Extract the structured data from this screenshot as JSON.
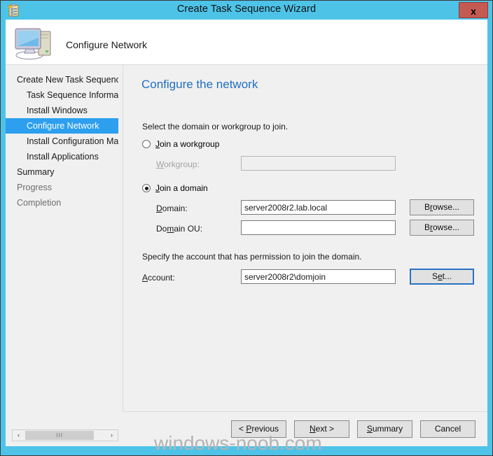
{
  "window": {
    "title": "Create Task Sequence Wizard",
    "title_icon": "task-sequence-clipboard-icon",
    "close_label": "x",
    "frame_color": "#4EC3E8",
    "close_color": "#C55A52"
  },
  "header": {
    "icon": "computer-icon",
    "title": "Configure Network"
  },
  "sidebar": {
    "items": [
      {
        "label": "Create New Task Sequence",
        "indent": false,
        "selected": false,
        "dim": false
      },
      {
        "label": "Task Sequence Information",
        "indent": true,
        "selected": false,
        "dim": false
      },
      {
        "label": "Install Windows",
        "indent": true,
        "selected": false,
        "dim": false
      },
      {
        "label": "Configure Network",
        "indent": true,
        "selected": true,
        "dim": false
      },
      {
        "label": "Install Configuration Manager",
        "indent": true,
        "selected": false,
        "dim": false
      },
      {
        "label": "Install Applications",
        "indent": true,
        "selected": false,
        "dim": false
      },
      {
        "label": "Summary",
        "indent": false,
        "selected": false,
        "dim": false
      },
      {
        "label": "Progress",
        "indent": false,
        "selected": false,
        "dim": true
      },
      {
        "label": "Completion",
        "indent": false,
        "selected": false,
        "dim": true
      }
    ],
    "selected_color": "#2C9FEE",
    "scrollbar": {
      "left_arrow": "‹",
      "right_arrow": "›",
      "grip": "III"
    }
  },
  "content": {
    "heading": "Configure the network",
    "heading_color": "#1F6FC4",
    "instruction_domain": "Select the domain or workgroup to join.",
    "instruction_account": "Specify the account that has permission to join the domain.",
    "radio_workgroup": {
      "label": "Join a workgroup",
      "selected": false
    },
    "radio_domain": {
      "label": "Join a domain",
      "selected": true
    },
    "fields": {
      "workgroup": {
        "label": "Workgroup:",
        "value": "",
        "placeholder": "",
        "disabled": true
      },
      "domain": {
        "label": "Domain:",
        "value": "server2008r2.lab.local",
        "placeholder": "",
        "disabled": false
      },
      "domain_ou": {
        "label": "Domain OU:",
        "value": "",
        "placeholder": "",
        "disabled": false
      },
      "account": {
        "label": "Account:",
        "value": "server2008r2\\domjoin",
        "placeholder": "",
        "disabled": false
      }
    },
    "buttons": {
      "browse_domain": "Browse...",
      "browse_domain_ou": "Browse...",
      "set_account": "Set..."
    }
  },
  "footer": {
    "previous": "< Previous",
    "next": "Next >",
    "summary": "Summary",
    "cancel": "Cancel"
  },
  "watermark": {
    "text": "windows-noob.com"
  }
}
